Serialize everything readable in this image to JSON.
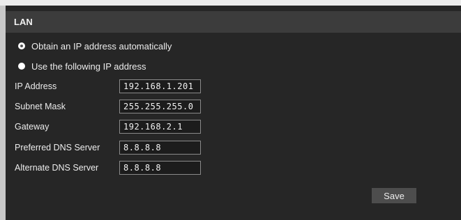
{
  "section": {
    "title": "LAN"
  },
  "ip_mode": {
    "options": [
      {
        "label": "Obtain an IP address automatically",
        "selected": true
      },
      {
        "label": "Use the following IP address",
        "selected": false
      }
    ]
  },
  "fields": [
    {
      "label": "IP Address",
      "value": "192.168.1.201"
    },
    {
      "label": "Subnet Mask",
      "value": "255.255.255.0"
    },
    {
      "label": "Gateway",
      "value": "192.168.2.1"
    },
    {
      "label": "Preferred DNS Server",
      "value": "8.8.8.8"
    },
    {
      "label": "Alternate DNS Server",
      "value": "8.8.8.8"
    }
  ],
  "actions": {
    "save_label": "Save"
  },
  "colors": {
    "panel_background": "#262626",
    "header_background": "#3c3c3c",
    "button_background": "#4d4d4d",
    "text": "#ececec"
  }
}
